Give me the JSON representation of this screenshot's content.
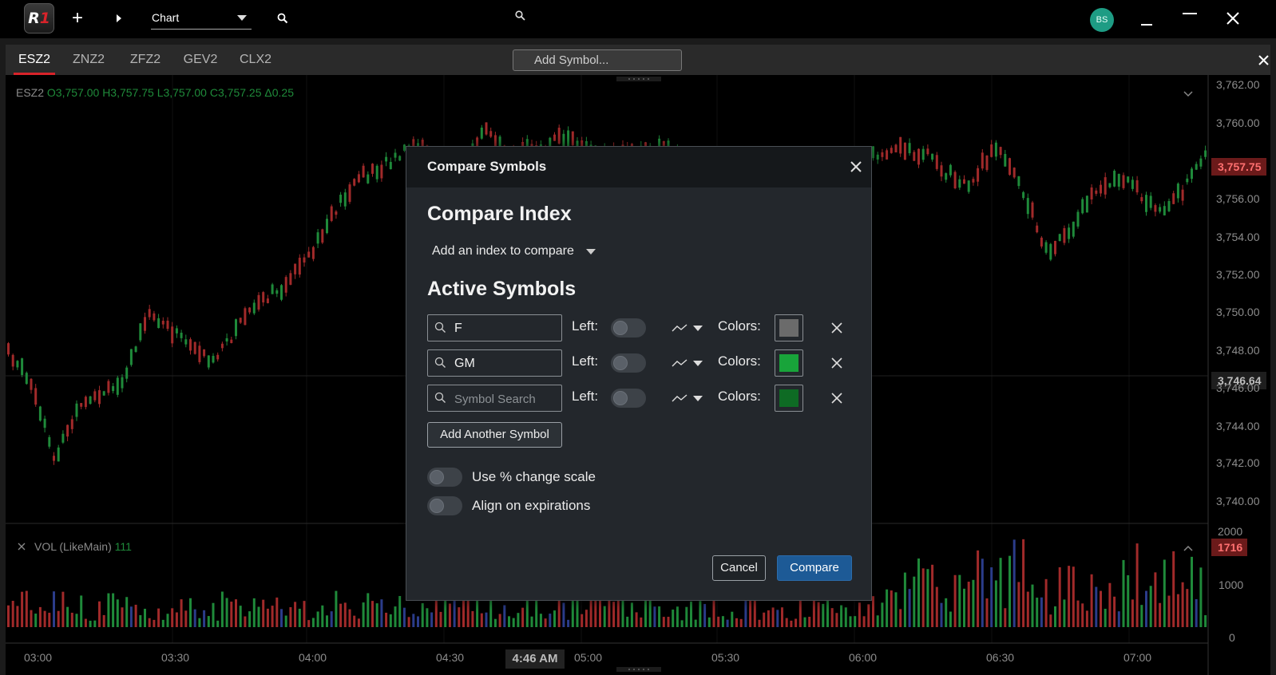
{
  "app": {
    "logo_text": "R",
    "logo_accent": "1",
    "layout_name": "Chart",
    "user_initials": "BS"
  },
  "tabs": [
    {
      "label": "ESZ2",
      "active": true
    },
    {
      "label": "ZNZ2",
      "active": false
    },
    {
      "label": "ZFZ2",
      "active": false
    },
    {
      "label": "GEV2",
      "active": false
    },
    {
      "label": "CLX2",
      "active": false
    }
  ],
  "symbol_search": {
    "placeholder": "Add Symbol..."
  },
  "chart": {
    "symbol": "ESZ2",
    "open": "O3,757.00",
    "high": "H3,757.75",
    "low": "L3,757.00",
    "close": "C3,757.25",
    "change": "Δ0.25",
    "price_axis": [
      "3,762.00",
      "3,760.00",
      "3,756.00",
      "3,754.00",
      "3,752.00",
      "3,750.00",
      "3,748.00",
      "3,746.00",
      "3,744.00",
      "3,742.00",
      "3,740.00"
    ],
    "last_price": "3,757.75",
    "crosshair_price": "3,746.64",
    "volume_label": "VOL (LikeMain)",
    "volume_value": "111",
    "volume_axis": [
      "2000",
      "1000",
      "0"
    ],
    "volume_last": "1716",
    "time_axis": [
      "03:00",
      "03:30",
      "04:00",
      "04:30",
      "05:00",
      "05:30",
      "06:00",
      "06:30",
      "07:00"
    ],
    "crosshair_time": "4:46 AM",
    "colors": {
      "up": "#1f8a3a",
      "down": "#a12a2a",
      "neutral": "#2b3c8a"
    }
  },
  "dialog": {
    "title": "Compare Symbols",
    "index_title": "Compare Index",
    "index_select": "Add an index to compare",
    "active_title": "Active Symbols",
    "left_label": "Left:",
    "colors_label": "Colors:",
    "symbols": [
      {
        "value": "F",
        "placeholder": "",
        "color": "#6b6b6b"
      },
      {
        "value": "GM",
        "placeholder": "",
        "color": "#18a43a"
      },
      {
        "value": "",
        "placeholder": "Symbol Search",
        "color": "#0e6b24"
      }
    ],
    "add_another": "Add Another Symbol",
    "pct_scale": "Use % change scale",
    "align_exp": "Align on expirations",
    "cancel": "Cancel",
    "compare": "Compare"
  }
}
